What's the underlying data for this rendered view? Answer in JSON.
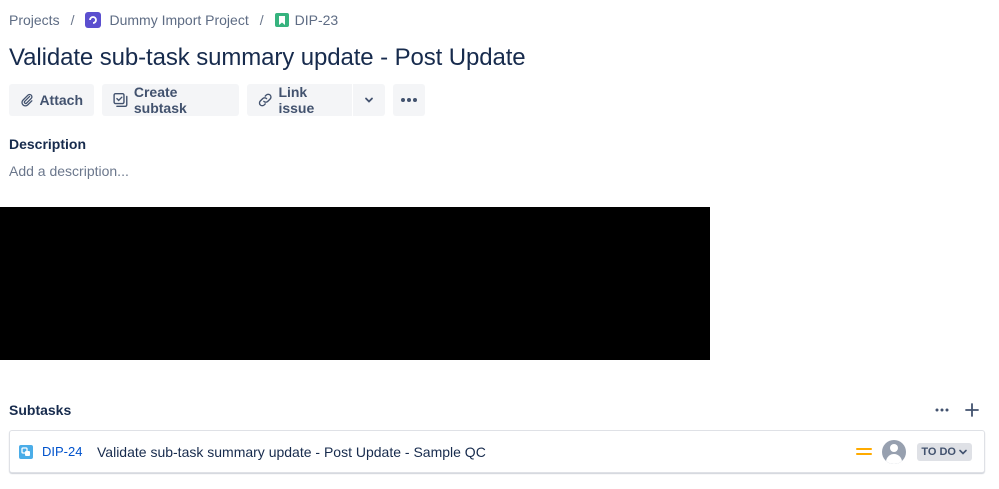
{
  "breadcrumb": {
    "projects": "Projects",
    "separator": "/",
    "project_name": "Dummy Import Project",
    "issue_key": "DIP-23"
  },
  "issue": {
    "title": "Validate sub-task summary update - Post Update"
  },
  "toolbar": {
    "attach_label": "Attach",
    "create_subtask_label": "Create subtask",
    "link_issue_label": "Link issue"
  },
  "description": {
    "label": "Description",
    "placeholder": "Add a description..."
  },
  "subtasks": {
    "label": "Subtasks",
    "items": [
      {
        "key": "DIP-24",
        "summary": "Validate sub-task summary update - Post Update - Sample QC",
        "priority": "medium",
        "status": "TO DO"
      }
    ]
  },
  "colors": {
    "link": "#0052cc",
    "project_avatar": "#5b4fcf",
    "story": "#36b37e",
    "subtask": "#4bade8",
    "priority_medium": "#ffab00"
  }
}
